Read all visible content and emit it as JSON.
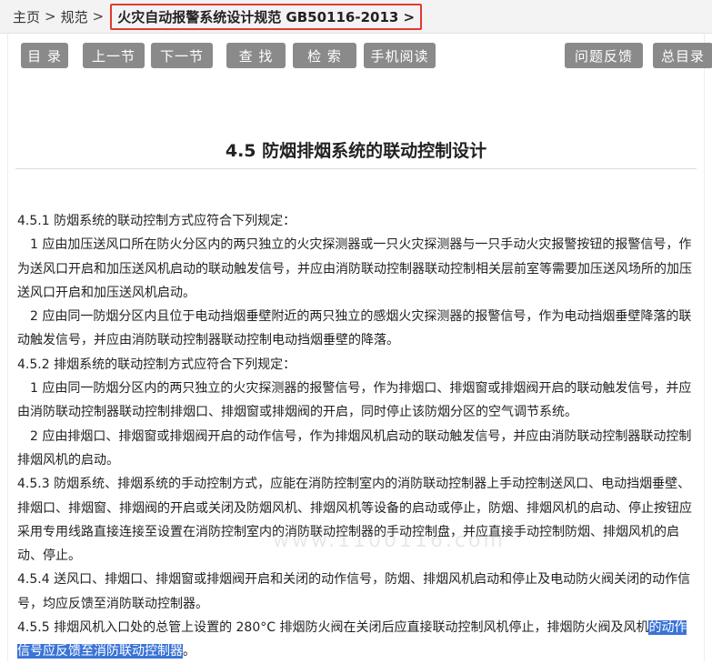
{
  "breadcrumb": {
    "home": "主页",
    "sep1": ">",
    "spec": "规范",
    "sep2": ">",
    "current": "火灾自动报警系统设计规范 GB50116-2013 >"
  },
  "toolbar": {
    "contents": "目 录",
    "prev": "上一节",
    "next": "下一节",
    "find": "查 找",
    "search": "检 索",
    "mobile": "手机阅读",
    "feedback": "问题反馈",
    "all_contents": "总目录"
  },
  "section": {
    "title": "4.5  防烟排烟系统的联动控制设计"
  },
  "paragraphs": {
    "p1": "4.5.1 防烟系统的联动控制方式应符合下列规定：",
    "p2": "1 应由加压送风口所在防火分区内的两只独立的火灾探测器或一只火灾探测器与一只手动火灾报警按钮的报警信号，作为送风口开启和加压送风机启动的联动触发信号，并应由消防联动控制器联动控制相关层前室等需要加压送风场所的加压送风口开启和加压送风机启动。",
    "p3": "2 应由同一防烟分区内且位于电动挡烟垂壁附近的两只独立的感烟火灾探测器的报警信号，作为电动挡烟垂壁降落的联动触发信号，并应由消防联动控制器联动控制电动挡烟垂壁的降落。",
    "p4": "4.5.2 排烟系统的联动控制方式应符合下列规定：",
    "p5": "1 应由同一防烟分区内的两只独立的火灾探测器的报警信号，作为排烟口、排烟窗或排烟阀开启的联动触发信号，并应由消防联动控制器联动控制排烟口、排烟窗或排烟阀的开启，同时停止该防烟分区的空气调节系统。",
    "p6": "2 应由排烟口、排烟窗或排烟阀开启的动作信号，作为排烟风机启动的联动触发信号，并应由消防联动控制器联动控制排烟风机的启动。",
    "p7": "4.5.3 防烟系统、排烟系统的手动控制方式，应能在消防控制室内的消防联动控制器上手动控制送风口、电动挡烟垂壁、排烟口、排烟窗、排烟阀的开启或关闭及防烟风机、排烟风机等设备的启动或停止，防烟、排烟风机的启动、停止按钮应采用专用线路直接连接至设置在消防控制室内的消防联动控制器的手动控制盘，并应直接手动控制防烟、排烟风机的启动、停止。",
    "p8": "4.5.4 送风口、排烟口、排烟窗或排烟阀开启和关闭的动作信号，防烟、排烟风机启动和停止及电动防火阀关闭的动作信号，均应反馈至消防联动控制器。",
    "p9_pre": "4.5.5 排烟风机入口处的总管上设置的 280°C 排烟防火阀在关闭后应直接联动控制风机停止，排烟防火阀及风机",
    "p9_hl": "的动作信号应反馈至消防联动控制器",
    "p9_post": "。"
  },
  "watermark": "www.1100116.com"
}
